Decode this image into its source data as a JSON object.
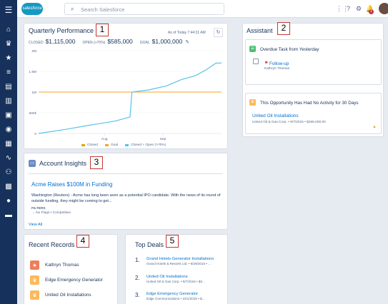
{
  "header": {
    "logo_text": "salesforce",
    "search_placeholder": "Search Salesforce"
  },
  "nav": {
    "icons": [
      "menu-icon",
      "home-icon",
      "crown-icon",
      "star-icon",
      "list-icon",
      "file-icon",
      "building-icon",
      "contact-card-icon",
      "globe-icon",
      "calendar-icon",
      "activity-icon",
      "users-icon",
      "calendar-grid-icon",
      "person-icon",
      "briefcase-icon"
    ]
  },
  "performance": {
    "title": "Quarterly Performance",
    "as_of": "As of Today 7:44:31 AM",
    "closed_label": "CLOSED",
    "closed_value": "$1,115,000",
    "open_label": "OPEN (>70%)",
    "open_value": "$585,000",
    "goal_label": "GOAL",
    "goal_value": "$1,000,000",
    "legend": [
      "Closed",
      "Goal",
      "Closed + Open (>70%)"
    ]
  },
  "chart_data": {
    "type": "line",
    "x_ticks": [
      "Aug",
      "Sep"
    ],
    "y_ticks": [
      "0",
      "500k",
      "1M",
      "1.5M",
      "2M"
    ],
    "ylim": [
      0,
      2000000
    ],
    "series": [
      {
        "name": "Closed",
        "color": "#e0a400",
        "values": []
      },
      {
        "name": "Goal",
        "color": "#f5a623",
        "values": [
          1000000,
          1000000
        ]
      },
      {
        "name": "Closed + Open (>70%)",
        "color": "#58c1ec",
        "values": [
          0,
          100000,
          200000,
          300000,
          350000,
          400000,
          1000000,
          1050000,
          1150000,
          1300000,
          1400000,
          1550000,
          1700000,
          1700000
        ]
      }
    ]
  },
  "insights": {
    "title": "Account Insights",
    "headline": "Acme Raises $100M in Funding",
    "body": "Washington (Reuters) - Acme has long been seen as a potential IPO candidate. With the news of its round of outside funding, they might be coming to get...",
    "filters_label": "FILTERS",
    "filters_value": "→ No Flags • Competitive",
    "view_all": "View All"
  },
  "assistant": {
    "title": "Assistant",
    "task_title": "Overdue Task from Yesterday",
    "task_name": "Follow-up",
    "task_sub": "Kathryn Thomas",
    "opp_title": "This Opportunity Has Had No Activity for 30 Days",
    "opp_name": "United Oil Installations",
    "opp_sub": "United Oil & Gas Corp. • 9/7/2015 • $265,000.00"
  },
  "recent": {
    "title": "Recent Records",
    "items": [
      {
        "label": "Kathryn Thomas",
        "color": "#ef7e5a",
        "icon": "star-icon"
      },
      {
        "label": "Edge Emergency Generator",
        "color": "#fcb95b",
        "icon": "crown-icon"
      },
      {
        "label": "United Oil Installations",
        "color": "#fcb95b",
        "icon": "crown-icon"
      }
    ]
  },
  "deals": {
    "title": "Top Deals",
    "items": [
      {
        "num": "1.",
        "name": "Grand Hotels Generator Installations",
        "sub": "Grand Hotels & Resorts Ltd. • 9/29/2015 • ..."
      },
      {
        "num": "2.",
        "name": "United Oil Installations",
        "sub": "United Oil & Gas Corp. • 9/7/2015 • $2..."
      },
      {
        "num": "3.",
        "name": "Edge Emergency Generator",
        "sub": "Edge Communications • 10/1/2015 • $..."
      }
    ]
  },
  "callouts": [
    "1",
    "2",
    "3",
    "4",
    "5"
  ]
}
